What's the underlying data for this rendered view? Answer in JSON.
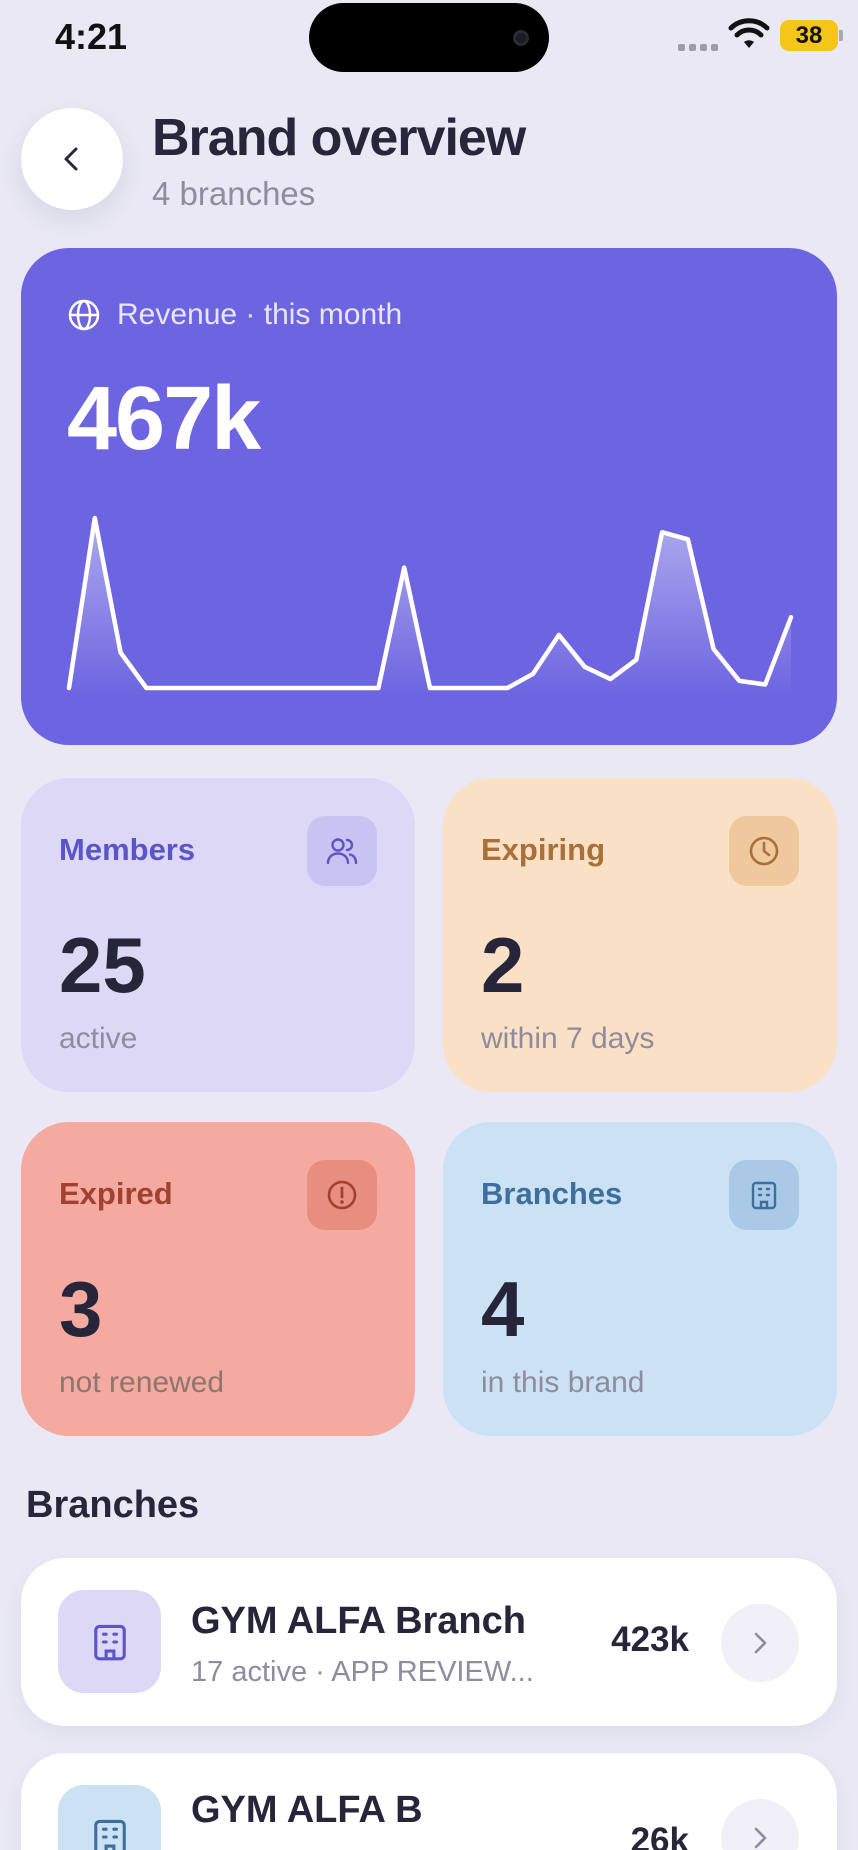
{
  "status_bar": {
    "time": "4:21",
    "battery": "38",
    "icons": [
      "cellular-icon",
      "wifi-icon",
      "battery-icon"
    ]
  },
  "header": {
    "back_icon": "chevron-left-icon",
    "title": "Brand overview",
    "subtitle": "4 branches"
  },
  "revenue": {
    "icon": "globe-icon",
    "label": "Revenue · this month",
    "value": "467k",
    "sparkline": [
      0,
      96,
      20,
      0,
      0,
      0,
      0,
      0,
      0,
      0,
      0,
      0,
      0,
      68,
      0,
      0,
      0,
      0,
      8,
      30,
      12,
      5,
      16,
      88,
      84,
      22,
      4,
      2,
      40
    ],
    "accent_color": "#6C64E0"
  },
  "stats": {
    "members": {
      "title": "Members",
      "value": "25",
      "caption": "active",
      "icon": "users-icon",
      "color": "#5C55C8"
    },
    "expiring": {
      "title": "Expiring",
      "value": "2",
      "caption": "within 7 days",
      "icon": "clock-icon",
      "color": "#A9703A"
    },
    "expired": {
      "title": "Expired",
      "value": "3",
      "caption": "not renewed",
      "icon": "alert-circle-icon",
      "color": "#A2412F"
    },
    "branches": {
      "title": "Branches",
      "value": "4",
      "caption": "in this brand",
      "icon": "building-icon",
      "color": "#3E6E9C"
    }
  },
  "branches_section": {
    "title": "Branches",
    "items": [
      {
        "name": "GYM ALFA Branch",
        "sub": "17 active · APP REVIEW...",
        "amount": "423k",
        "icon": "building-icon"
      },
      {
        "name": "GYM ALFA B",
        "sub": "",
        "amount": "26k",
        "icon": "building-icon"
      }
    ]
  }
}
